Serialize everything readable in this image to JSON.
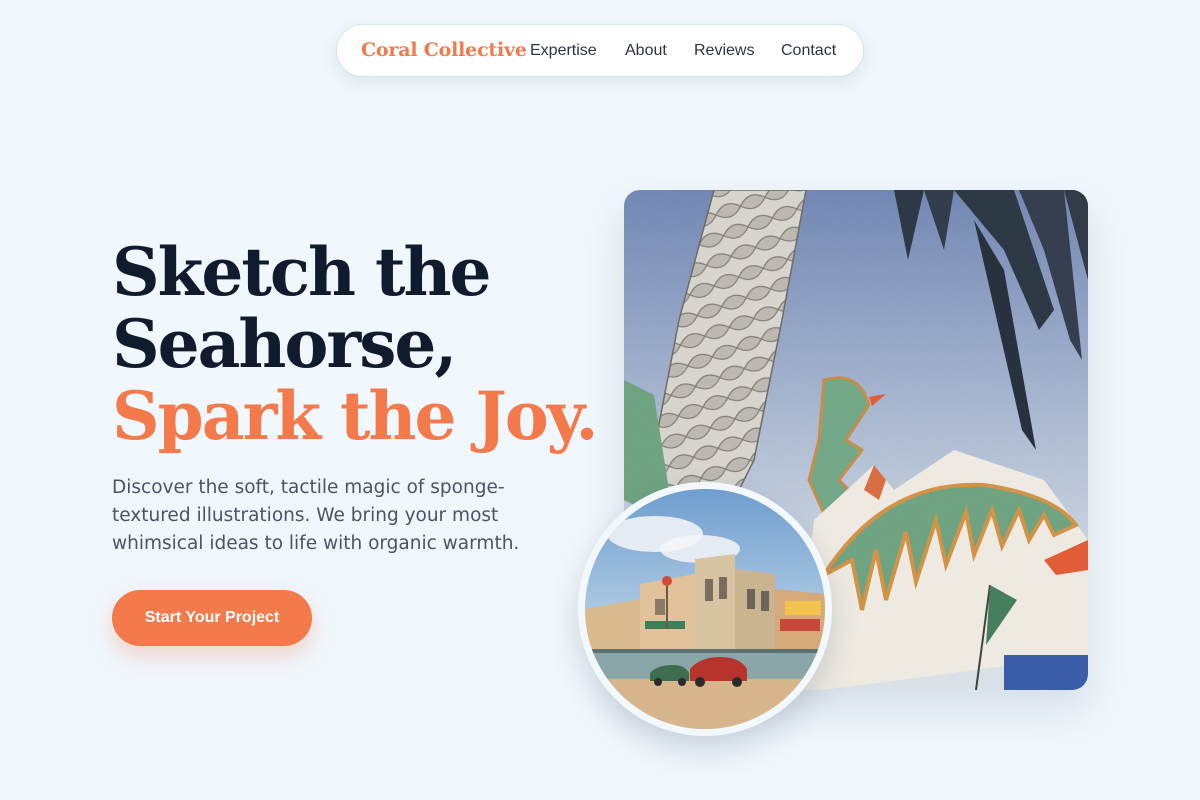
{
  "nav": {
    "brand": "Coral Collective",
    "links": [
      "Expertise",
      "About",
      "Reviews",
      "Contact"
    ]
  },
  "hero": {
    "title_line1": "Sketch the",
    "title_line2": "Seahorse,",
    "title_accent": "Spark the Joy.",
    "description": "Discover the soft, tactile magic of sponge-textured illustrations. We bring your most whimsical ideas to life with organic warmth.",
    "cta_label": "Start Your Project"
  },
  "colors": {
    "background": "#f0f7fd",
    "accent": "#f47a4b",
    "heading": "#111b2e",
    "body_text": "#4a5466"
  }
}
